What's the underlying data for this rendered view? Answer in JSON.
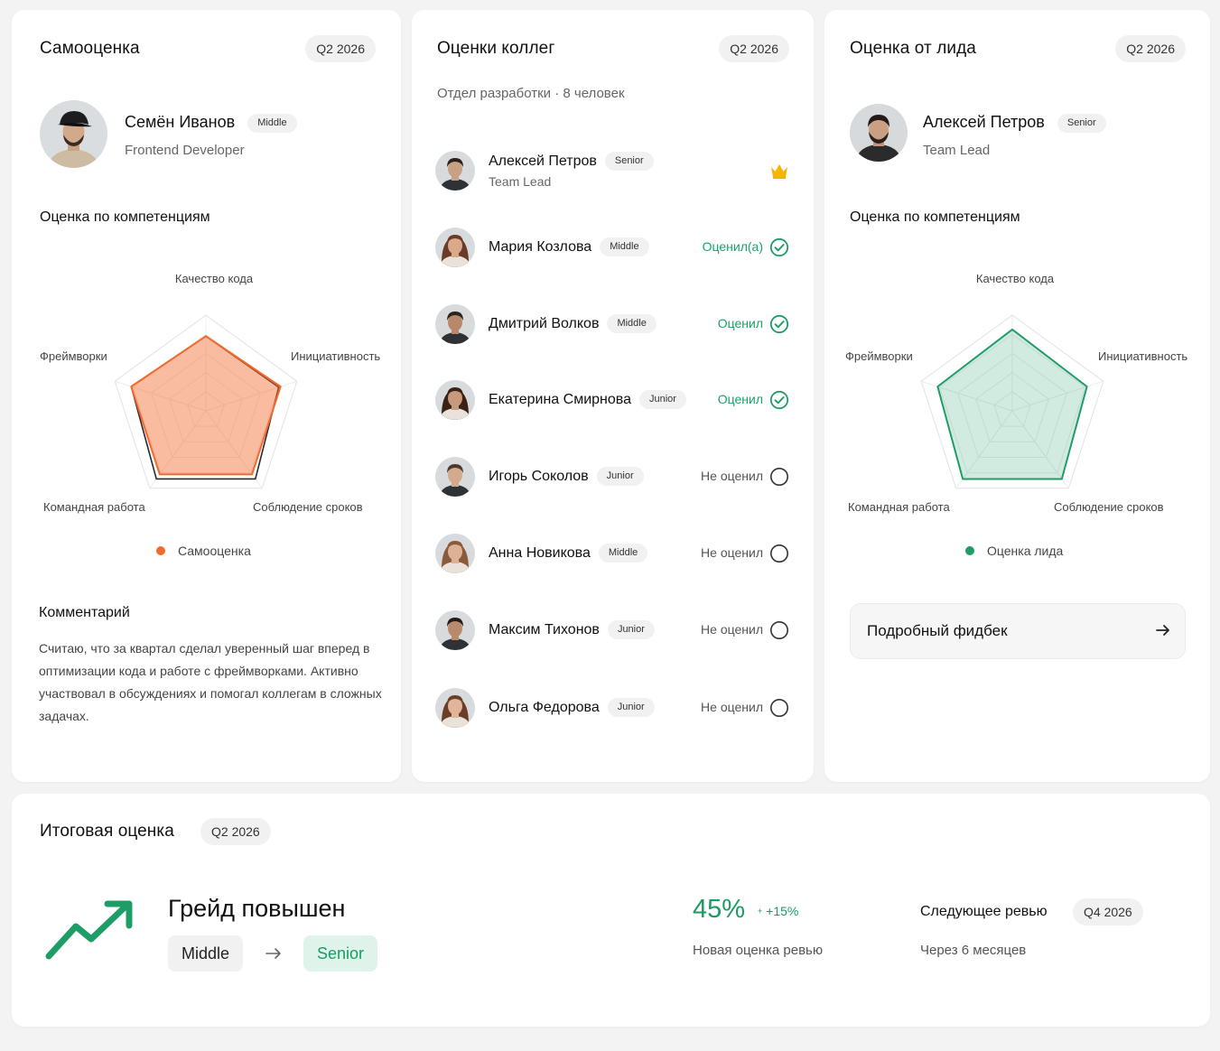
{
  "quarter_label": "Q2 2026",
  "self": {
    "title": "Самооценка",
    "quarter": "Q2 2026",
    "name": "Семён Иванов",
    "level": "Middle",
    "role": "Frontend Developer",
    "competencies_title": "Оценка по компетенциям",
    "legend": "Самооценка",
    "comment_title": "Комментарий",
    "comment": "Считаю, что за квартал сделал уверенный шаг вперед в оптимизации кода и работе с фреймворками. Активно участвовал в обсуждениях и помогал коллегам в сложных задачах.",
    "color": "#f26a2e"
  },
  "peers": {
    "title": "Оценки коллег",
    "quarter": "Q2 2026",
    "subtitle": "Отдел разработки · 8 человек",
    "items": [
      {
        "name": "Алексей Петров",
        "level": "Senior",
        "role": "Team Lead",
        "status": "",
        "state": "lead",
        "icon": "crown-icon"
      },
      {
        "name": "Мария Козлова",
        "level": "Middle",
        "status": "Оценил(а)",
        "state": "done",
        "icon": "check-circle-icon"
      },
      {
        "name": "Дмитрий Волков",
        "level": "Middle",
        "status": "Оценил",
        "state": "done",
        "icon": "check-circle-icon"
      },
      {
        "name": "Екатерина Смирнова",
        "level": "Junior",
        "status": "Оценил",
        "state": "done",
        "icon": "check-circle-icon"
      },
      {
        "name": "Игорь Соколов",
        "level": "Junior",
        "status": "Не оценил",
        "state": "none",
        "icon": "empty-circle-icon"
      },
      {
        "name": "Анна Новикова",
        "level": "Middle",
        "status": "Не оценил",
        "state": "none",
        "icon": "empty-circle-icon"
      },
      {
        "name": "Максим Тихонов",
        "level": "Junior",
        "status": "Не оценил",
        "state": "none",
        "icon": "empty-circle-icon"
      },
      {
        "name": "Ольга Федорова",
        "level": "Junior",
        "status": "Не оценил",
        "state": "none",
        "icon": "empty-circle-icon"
      }
    ]
  },
  "lead": {
    "title": "Оценка от лида",
    "quarter": "Q2 2026",
    "name": "Алексей Петров",
    "level": "Senior",
    "role": "Team Lead",
    "competencies_title": "Оценка по компетенциям",
    "legend": "Оценка лида",
    "feedback_button": "Подробный фидбек",
    "color": "#1f9d66"
  },
  "final": {
    "title": "Итоговая оценка",
    "quarter": "Q2 2026",
    "grade_title": "Грейд повышен",
    "grade_from": "Middle",
    "grade_to": "Senior",
    "score": "45%",
    "score_delta": "+15%",
    "score_label": "Новая оценка ревью",
    "next_title": "Следующее ревью",
    "next_quarter": "Q4 2026",
    "next_sub": "Через 6 месяцев"
  },
  "chart_data": [
    {
      "type": "radar",
      "axes": [
        "Качество кода",
        "Инициативность",
        "Соблюдение сроков",
        "Командная работа",
        "Фреймворки"
      ],
      "series": [
        {
          "name": "Самооценка",
          "values": [
            0.78,
            0.82,
            0.82,
            0.82,
            0.82
          ]
        }
      ],
      "range": [
        0,
        1
      ]
    },
    {
      "type": "radar",
      "axes": [
        "Качество кода",
        "Инициативность",
        "Соблюдение сроков",
        "Командная работа",
        "Фреймворки"
      ],
      "series": [
        {
          "name": "Оценка лида",
          "values": [
            0.85,
            0.82,
            0.88,
            0.88,
            0.82
          ]
        }
      ],
      "range": [
        0,
        1
      ]
    }
  ]
}
